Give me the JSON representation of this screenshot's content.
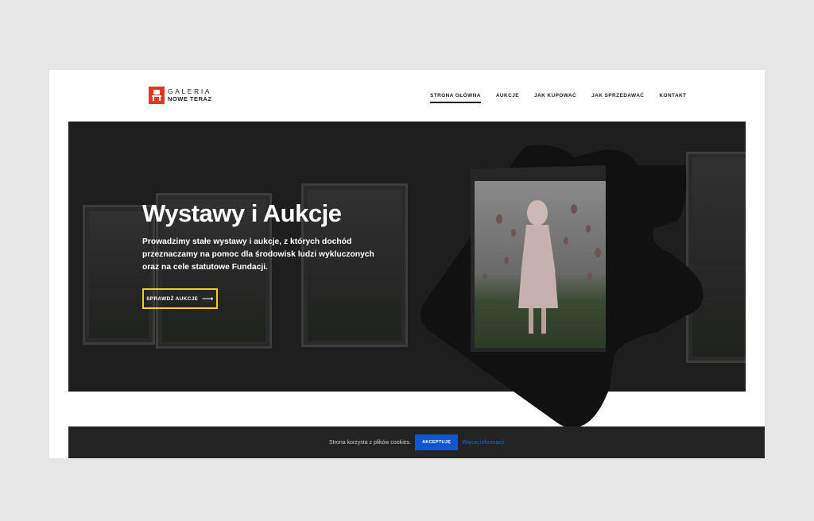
{
  "logo": {
    "line1": "GALERIA",
    "line2": "NOWE TERAZ"
  },
  "nav": {
    "items": [
      {
        "label": "STRONA GŁÓWNA"
      },
      {
        "label": "AUKCJE"
      },
      {
        "label": "JAK KUPOWAĆ"
      },
      {
        "label": "JAK SPRZEDAWAĆ"
      },
      {
        "label": "KONTAKT"
      }
    ]
  },
  "hero": {
    "title": "Wystawy i Aukcje",
    "text": "Prowadzimy stałe wystawy i aukcje, z których dochód przeznaczamy na pomoc dla środowisk ludzi wykluczonych oraz na cele statutowe Fundacji.",
    "button_label": "SPRAWDŹ AUKCJE",
    "button_icon": "arrow-right-icon"
  },
  "cookie": {
    "text": "Strona korzysta z plików cookies.",
    "accept_label": "AKCEPTUJĘ",
    "more_label": "Więcej informacji"
  },
  "colors": {
    "accent_red": "#e0381d",
    "button_border": "#f1d015",
    "cookie_button": "#0c57d2",
    "link_blue": "#1f64e0"
  }
}
